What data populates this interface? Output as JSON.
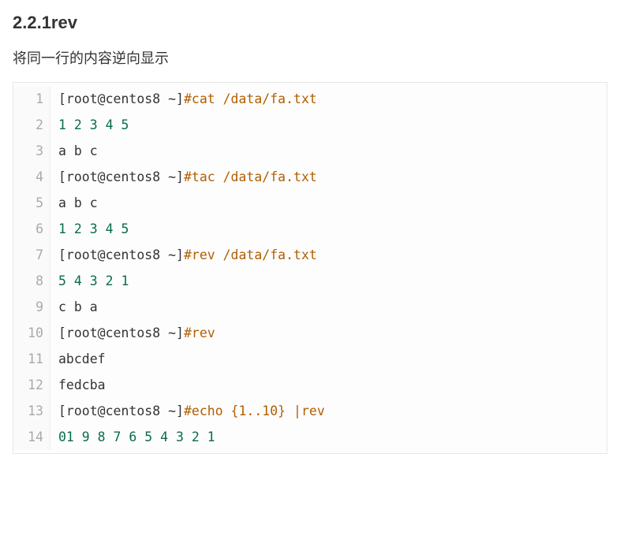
{
  "heading": "2.2.1rev",
  "description": "将同一行的内容逆向显示",
  "code": {
    "lines": [
      {
        "num": "1",
        "tokens": [
          {
            "cls": "tok-black",
            "t": "[root@centos8 ~]"
          },
          {
            "cls": "tok-comment",
            "t": "#cat /data/fa.txt"
          }
        ]
      },
      {
        "num": "2",
        "tokens": [
          {
            "cls": "tok-number",
            "t": "1 2 3 4 5"
          }
        ]
      },
      {
        "num": "3",
        "tokens": [
          {
            "cls": "tok-black",
            "t": "a b c"
          }
        ]
      },
      {
        "num": "4",
        "tokens": [
          {
            "cls": "tok-black",
            "t": "[root@centos8 ~]"
          },
          {
            "cls": "tok-comment",
            "t": "#tac /data/fa.txt"
          }
        ]
      },
      {
        "num": "5",
        "tokens": [
          {
            "cls": "tok-black",
            "t": "a b c"
          }
        ]
      },
      {
        "num": "6",
        "tokens": [
          {
            "cls": "tok-number",
            "t": "1 2 3 4 5"
          }
        ]
      },
      {
        "num": "7",
        "tokens": [
          {
            "cls": "tok-black",
            "t": "[root@centos8 ~]"
          },
          {
            "cls": "tok-comment",
            "t": "#rev /data/fa.txt"
          }
        ]
      },
      {
        "num": "8",
        "tokens": [
          {
            "cls": "tok-number",
            "t": "5 4 3 2 1"
          }
        ]
      },
      {
        "num": "9",
        "tokens": [
          {
            "cls": "tok-black",
            "t": "c b a"
          }
        ]
      },
      {
        "num": "10",
        "tokens": [
          {
            "cls": "tok-black",
            "t": "[root@centos8 ~]"
          },
          {
            "cls": "tok-comment",
            "t": "#rev"
          }
        ]
      },
      {
        "num": "11",
        "tokens": [
          {
            "cls": "tok-black",
            "t": "abcdef"
          }
        ]
      },
      {
        "num": "12",
        "tokens": [
          {
            "cls": "tok-black",
            "t": "fedcba"
          }
        ]
      },
      {
        "num": "13",
        "tokens": [
          {
            "cls": "tok-black",
            "t": "[root@centos8 ~]"
          },
          {
            "cls": "tok-comment",
            "t": "#echo {1..10} |rev"
          }
        ]
      },
      {
        "num": "14",
        "tokens": [
          {
            "cls": "tok-number",
            "t": "01 9 8 7 6 5 4 3 2 1"
          }
        ]
      }
    ]
  }
}
